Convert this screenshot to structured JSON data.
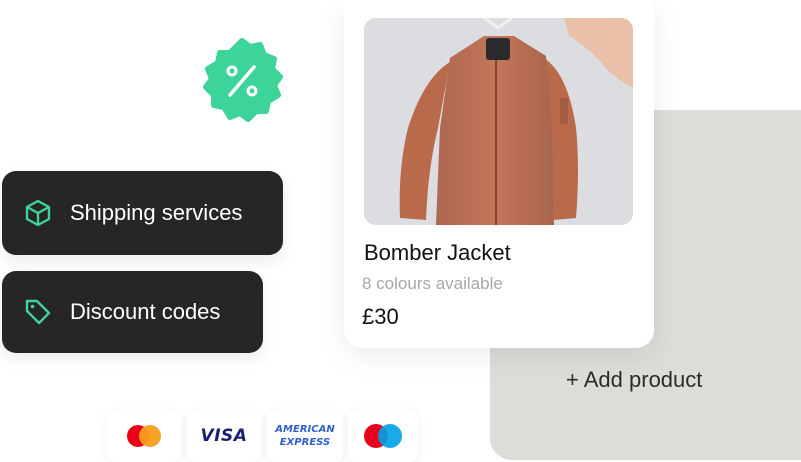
{
  "badges": {
    "discount_icon": "percent-badge-icon",
    "accent_color": "#3dd49a"
  },
  "features": [
    {
      "label": "Shipping services",
      "icon": "box-icon"
    },
    {
      "label": "Discount codes",
      "icon": "tag-icon"
    }
  ],
  "product": {
    "name": "Bomber Jacket",
    "colours": "8 colours available",
    "price": "£30",
    "image_icon": "jacket-image"
  },
  "add_product": {
    "label": "+ Add product"
  },
  "payments": {
    "mastercard_icon": "mastercard-icon",
    "visa_label": "VISA",
    "amex_line1": "AMERICAN",
    "amex_line2": "EXPRESS",
    "maestro_icon": "maestro-icon"
  }
}
